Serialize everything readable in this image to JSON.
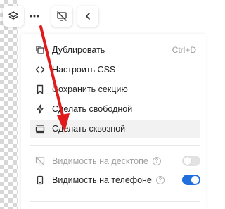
{
  "toolbar": {
    "buttons": [
      {
        "name": "layers-icon"
      },
      {
        "name": "more-icon"
      },
      {
        "name": "hide-desktop-icon"
      },
      {
        "name": "chevron-left-icon"
      }
    ]
  },
  "menu": {
    "items": [
      {
        "label": "Дублировать",
        "shortcut": "Ctrl+D",
        "icon": "duplicate-icon"
      },
      {
        "label": "Настроить CSS",
        "icon": "code-icon"
      },
      {
        "label": "Сохранить секцию",
        "icon": "bookmark-icon"
      },
      {
        "label": "Сделать свободной",
        "icon": "lightning-icon"
      },
      {
        "label": "Сделать сквозной",
        "icon": "section-icon",
        "highlighted": true
      }
    ],
    "visibility": [
      {
        "label": "Видимость на десктопе",
        "enabled": false
      },
      {
        "label": "Видимость на телефоне",
        "enabled": true
      }
    ]
  },
  "colors": {
    "accent": "#1f6fdc",
    "arrow": "#e01b1b"
  }
}
